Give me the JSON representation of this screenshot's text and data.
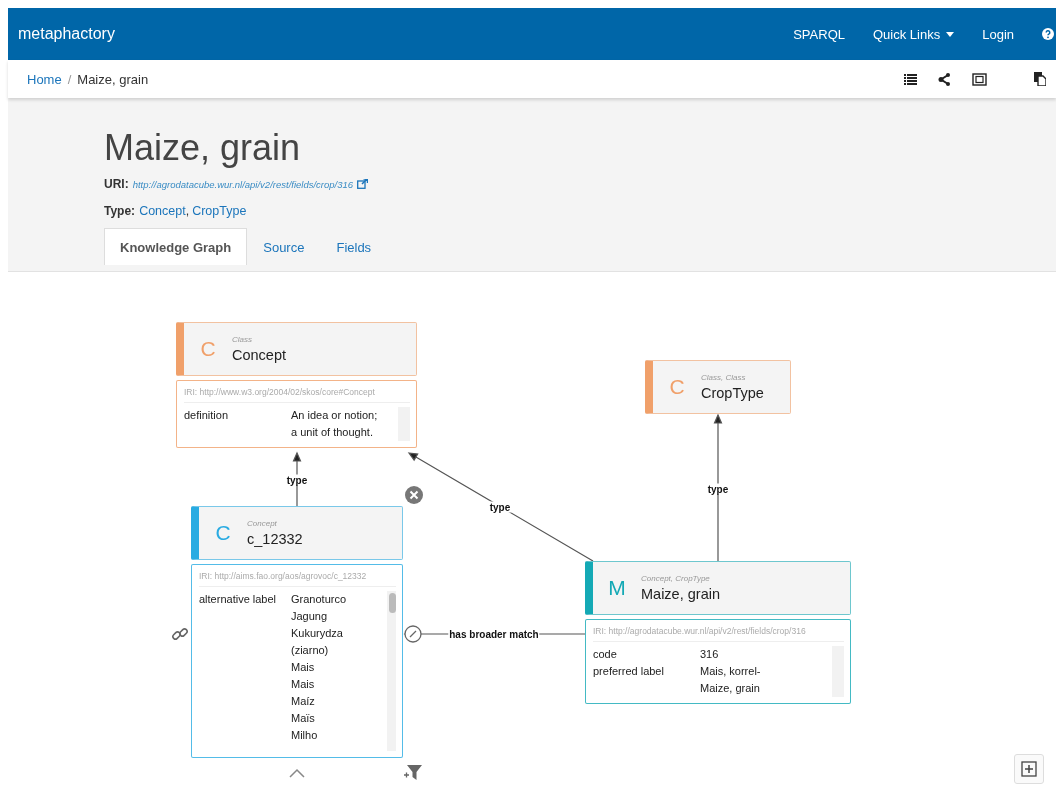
{
  "navbar": {
    "brand": "metaphactory",
    "links": [
      {
        "label": "SPARQL",
        "kind": "link"
      },
      {
        "label": "Quick Links",
        "kind": "dropdown"
      },
      {
        "label": "Login",
        "kind": "link"
      }
    ]
  },
  "breadcrumb": [
    {
      "label": "Home",
      "kind": "link"
    },
    {
      "label": "/",
      "kind": "separator"
    },
    {
      "label": "Maize, grain",
      "kind": "current"
    }
  ],
  "page": {
    "title": "Maize, grain",
    "uri_label": "URI:",
    "uri": "http://agrodatacube.wur.nl/api/v2/rest/fields/crop/316",
    "type_label": "Type:",
    "type_separator": ",",
    "types": [
      "Concept",
      "CropType"
    ]
  },
  "tabs": [
    {
      "label": "Knowledge Graph",
      "selected": true
    },
    {
      "label": "Source",
      "selected": false
    },
    {
      "label": "Fields",
      "selected": false
    }
  ],
  "graph": {
    "nodes": [
      {
        "letter": "C",
        "types": "Class",
        "label": "Concept",
        "color": "#f0a06a",
        "iri": "IRI: http://www.w3.org/2004/02/skos/core#Concept",
        "properties": [
          {
            "name": "definition",
            "values": [
              "An idea or notion; a unit of thought."
            ]
          }
        ]
      },
      {
        "letter": "C",
        "types": "Class, Class",
        "label": "CropType",
        "color": "#f0a06a"
      },
      {
        "letter": "C",
        "types": "Concept",
        "label": "c_12332",
        "color": "#29abe2",
        "iri": "IRI: http://aims.fao.org/aos/agrovoc/c_12332",
        "properties": [
          {
            "name": "alternative label",
            "values": [
              "Granoturco",
              "Jagung",
              "Kukurydza (ziarno)",
              "Mais",
              "Mais",
              "Maíz",
              "Maïs",
              "Milho"
            ]
          }
        ]
      },
      {
        "letter": "M",
        "types": "Concept, CropType",
        "label": "Maize, grain",
        "color": "#14a9b5",
        "iri": "IRI: http://agrodatacube.wur.nl/api/v2/rest/fields/crop/316",
        "properties": [
          {
            "name": "code",
            "values": [
              "316"
            ]
          },
          {
            "name": "preferred label",
            "values": [
              "Mais, korrel-",
              "Maize, grain"
            ]
          }
        ]
      }
    ],
    "edges": [
      {
        "label": "type"
      },
      {
        "label": "type"
      },
      {
        "label": "type"
      },
      {
        "label": "has broader match"
      }
    ]
  }
}
